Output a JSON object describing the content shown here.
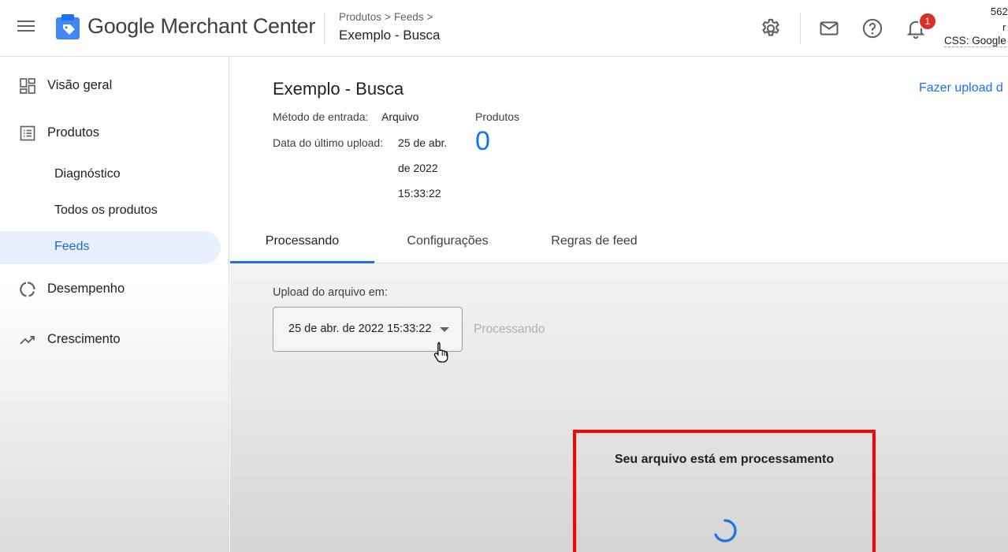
{
  "header": {
    "brand_google": "Google",
    "brand_product": "Merchant Center",
    "breadcrumb": [
      "Produtos",
      "Feeds"
    ],
    "page_title": "Exemplo - Busca",
    "notification_count": "1",
    "account_id": "562",
    "account_line2": "r",
    "account_css": "CSS: Google"
  },
  "sidebar": {
    "items": [
      {
        "label": "Visão geral",
        "icon": "dashboard-icon"
      },
      {
        "label": "Produtos",
        "icon": "list-icon"
      },
      {
        "label": "Diagnóstico"
      },
      {
        "label": "Todos os produtos"
      },
      {
        "label": "Feeds",
        "active": true
      },
      {
        "label": "Desempenho",
        "icon": "donut-chart-icon"
      },
      {
        "label": "Crescimento",
        "icon": "trending-up-icon"
      }
    ]
  },
  "feed": {
    "title": "Exemplo - Busca",
    "upload_link": "Fazer upload d",
    "input_method_label": "Método de entrada:",
    "input_method_value": "Arquivo",
    "last_upload_label": "Data do último upload:",
    "last_upload_lines": [
      "25 de abr.",
      "de 2022",
      "15:33:22"
    ],
    "products_label": "Produtos",
    "products_count": "0"
  },
  "tabs": [
    {
      "label": "Processando",
      "active": true
    },
    {
      "label": "Configurações"
    },
    {
      "label": "Regras de feed"
    }
  ],
  "processing": {
    "upload_label": "Upload do arquivo em:",
    "selected_upload": "25 de abr. de 2022 15:33:22",
    "status": "Processando",
    "message": "Seu arquivo está em processamento"
  },
  "colors": {
    "accent": "#1a73e8",
    "highlight_border": "#ff0000",
    "badge": "#d93025",
    "active_nav_bg": "#e8f0fe"
  }
}
